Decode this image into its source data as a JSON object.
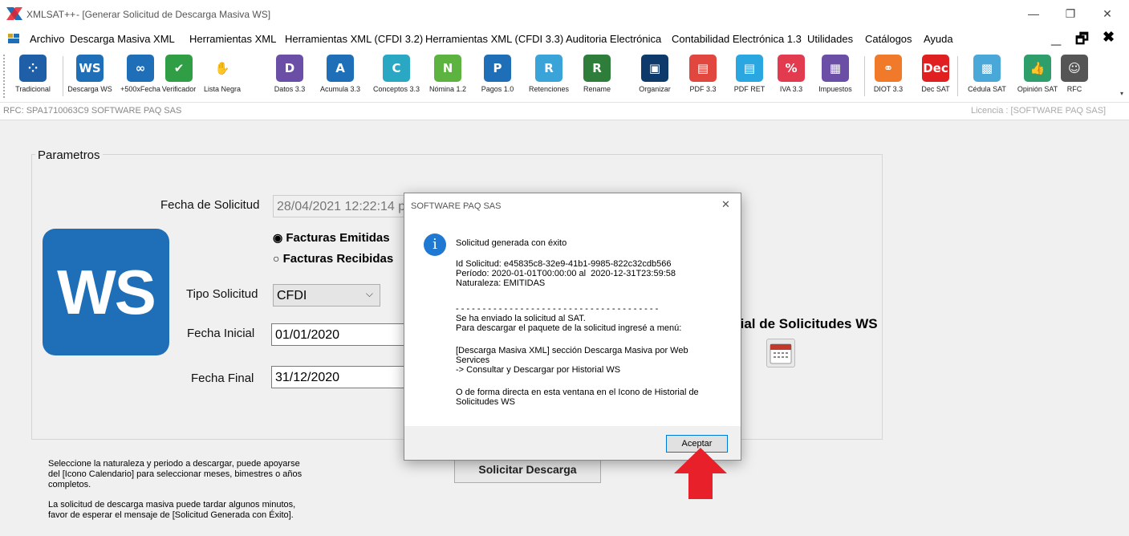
{
  "window": {
    "app_name": "XMLSAT++",
    "doc_title": "- [Generar Solicitud de Descarga Masiva WS]",
    "minimize": "—",
    "restore": "❐",
    "close": "✕"
  },
  "menu": [
    "Archivo",
    "Descarga Masiva XML",
    "Herramientas XML",
    "Herramientas XML (CFDI 3.2)",
    "Herramientas XML (CFDI 3.3)",
    "Auditoria Electrónica",
    "Contabilidad Electrónica 1.3",
    "Utilidades",
    "Catálogos",
    "Ayuda"
  ],
  "menu_controls": {
    "minimize": "_",
    "restore": "🗗",
    "close": "✖"
  },
  "toolbar": [
    {
      "label": "Tradicional",
      "glyph": "⁘",
      "color": "#1f5fa8",
      "icon": "tradicional-icon"
    },
    {
      "label": "Descarga WS",
      "glyph": "WS",
      "color": "#1f6fb8",
      "icon": "ws-icon"
    },
    {
      "label": "+500xFecha",
      "glyph": "∞",
      "color": "#1f6fb8",
      "icon": "500-fecha-icon"
    },
    {
      "label": "Verificador",
      "glyph": "✔",
      "color": "#2f9e45",
      "icon": "check-icon"
    },
    {
      "label": "Lista Negra",
      "glyph": "✋",
      "color": "#ffffff",
      "icon": "lista-negra-icon"
    },
    {
      "label": "Datos 3.3",
      "glyph": "D",
      "color": "#6b4fa6",
      "icon": "datos-icon"
    },
    {
      "label": "Acumula 3.3",
      "glyph": "A",
      "color": "#1f6fb8",
      "icon": "acumula-icon"
    },
    {
      "label": "Conceptos 3.3",
      "glyph": "C",
      "color": "#2aa7c2",
      "icon": "conceptos-icon"
    },
    {
      "label": "Nómina 1.2",
      "glyph": "N",
      "color": "#5db340",
      "icon": "nomina-icon"
    },
    {
      "label": "Pagos 1.0",
      "glyph": "P",
      "color": "#1f6fb8",
      "icon": "pagos-icon"
    },
    {
      "label": "Retenciones",
      "glyph": "R",
      "color": "#3aa3d8",
      "icon": "retenciones-icon"
    },
    {
      "label": "Rename",
      "glyph": "R",
      "color": "#2e7d3a",
      "icon": "rename-icon"
    },
    {
      "label": "Organizar",
      "glyph": "▣",
      "color": "#0d3a6b",
      "icon": "organizar-icon"
    },
    {
      "label": "PDF 3.3",
      "glyph": "▤",
      "color": "#e2473f",
      "icon": "pdf-icon"
    },
    {
      "label": "PDF RET",
      "glyph": "▤",
      "color": "#2aa7e0",
      "icon": "pdf-ret-icon"
    },
    {
      "label": "IVA 3.3",
      "glyph": "%",
      "color": "#e23b4f",
      "icon": "iva-icon"
    },
    {
      "label": "Impuestos",
      "glyph": "▦",
      "color": "#6b4fa6",
      "icon": "impuestos-icon"
    },
    {
      "label": "DIOT 3.3",
      "glyph": "⚭",
      "color": "#f07a2a",
      "icon": "diot-icon"
    },
    {
      "label": "Dec SAT",
      "glyph": "Dec",
      "color": "#e02020",
      "icon": "dec-sat-icon"
    },
    {
      "label": "Cédula SAT",
      "glyph": "▩",
      "color": "#4aa8d8",
      "icon": "cedula-icon"
    },
    {
      "label": "Opinión SAT",
      "glyph": "👍",
      "color": "#2e9e6a",
      "icon": "opinion-icon"
    },
    {
      "label": "RFC",
      "glyph": "☺",
      "color": "#555555",
      "icon": "rfc-icon"
    }
  ],
  "rfc_bar": {
    "rfc": "RFC: SPA1710063C9 SOFTWARE PAQ SAS",
    "license": "Licencia : [SOFTWARE PAQ SAS]"
  },
  "form": {
    "group_title": "Parametros",
    "ws_logo": "WS",
    "fecha_solicitud_label": "Fecha de Solicitud",
    "fecha_solicitud_value": "28/04/2021 12:22:14 p. m.",
    "radio_emitidas": "Facturas Emitidas",
    "radio_recibidas": "Facturas Recibidas",
    "tipo_label": "Tipo Solicitud",
    "tipo_value": "CFDI",
    "fecha_inicial_label": "Fecha Inicial",
    "fecha_inicial_value": "01/01/2020",
    "fecha_final_label": "Fecha Final",
    "fecha_final_value": "31/12/2020",
    "historial_label": "rial de Solicitudes WS",
    "solicitar_button": "Solicitar Descarga",
    "help_1": "Seleccione la naturaleza y periodo a descargar, puede apoyarse\ndel [Icono Calendario] para seleccionar meses, bimestres o años\ncompletos.",
    "help_2": "La solicitud de descarga masiva puede tardar algunos minutos,\nfavor de esperar el mensaje de [Solicitud Generada con Éxito]."
  },
  "dialog": {
    "title": "SOFTWARE PAQ SAS",
    "close": "✕",
    "info_glyph": "i",
    "line1": "Solicitud generada con éxito",
    "line2": "Id Solicitud: e45835c8-32e9-41b1-9985-822c32cdb566\nPeríodo: 2020-01-01T00:00:00 al  2020-12-31T23:59:58\nNaturaleza: EMITIDAS",
    "line3": "- - - - - - - - - - - - - - - - - - - - - - - - - - - - - - - - - - - - - -\nSe ha enviado la solicitud al SAT.\nPara descargar el paquete de la solicitud ingresé a menú:",
    "line4": "[Descarga Masiva XML] sección Descarga Masiva por Web\nServices\n-> Consultar y Descargar por Historial WS",
    "line5": "O de forma directa en esta ventana en el Icono de Historial de\nSolicitudes WS",
    "ok_button": "Aceptar"
  },
  "colors": {
    "accent": "#1f6fb8",
    "arrow": "#e8202a",
    "dialog_footer": "#f0f0f0"
  }
}
